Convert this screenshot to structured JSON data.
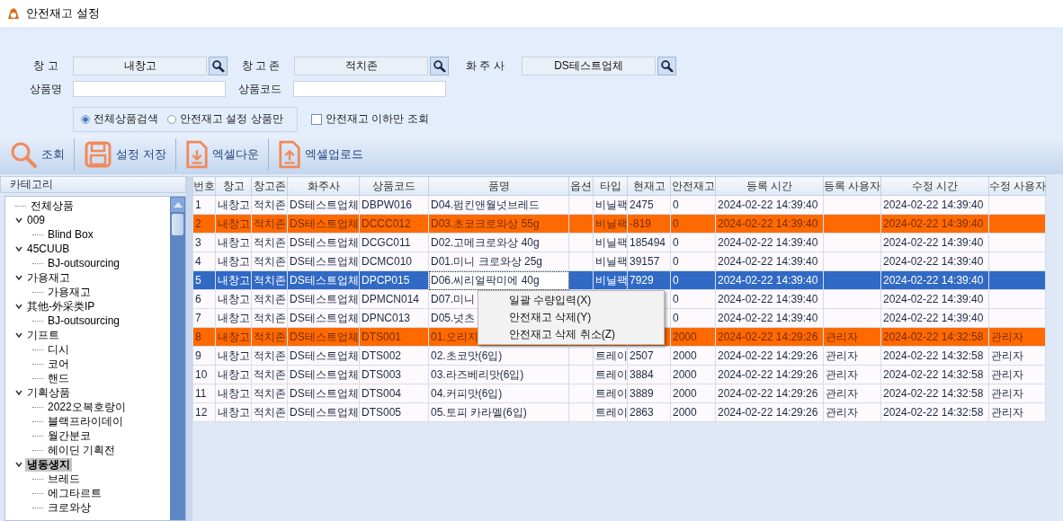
{
  "window": {
    "title": "안전재고 설정"
  },
  "filters": {
    "warehouse": {
      "label": "창 고",
      "value": "내창고"
    },
    "zone": {
      "label": "창 고 존",
      "value": "적치존"
    },
    "owner": {
      "label": "화 주 사",
      "value": "DS테스트업체"
    },
    "product_name": {
      "label": "상품명"
    },
    "product_code": {
      "label": "상품코드"
    },
    "scope": [
      {
        "label": "전체상품검색",
        "selected": true
      },
      {
        "label": "안전재고 설정 상품만",
        "selected": false
      }
    ],
    "below_safety": {
      "label": "안전재고 이하만 조회",
      "checked": false
    }
  },
  "toolbar": [
    {
      "kind": "search",
      "label": "조회"
    },
    {
      "kind": "save",
      "label": "설정 저장"
    },
    {
      "kind": "download",
      "label": "엑셀다운"
    },
    {
      "kind": "upload",
      "label": "엑셀업로드"
    }
  ],
  "category": {
    "title": "카테고리",
    "tree": [
      {
        "label": "전체상품",
        "selected": false
      },
      {
        "label": "009",
        "expanded": true,
        "selected": false,
        "children": [
          {
            "label": "Blind Box",
            "selected": false
          }
        ]
      },
      {
        "label": "45CUUB",
        "expanded": true,
        "selected": false,
        "children": [
          {
            "label": "BJ-outsourcing",
            "selected": false
          }
        ]
      },
      {
        "label": "가용재고",
        "expanded": true,
        "selected": false,
        "children": [
          {
            "label": "가용재고",
            "selected": false
          }
        ]
      },
      {
        "label": "其他-外采类IP",
        "expanded": true,
        "selected": false,
        "children": [
          {
            "label": "BJ-outsourcing",
            "selected": false
          }
        ]
      },
      {
        "label": "기프트",
        "expanded": true,
        "selected": false,
        "children": [
          {
            "label": "디시",
            "selected": false
          },
          {
            "label": "코어",
            "selected": false
          },
          {
            "label": "핸드",
            "selected": false
          }
        ]
      },
      {
        "label": "기획상품",
        "expanded": true,
        "selected": false,
        "children": [
          {
            "label": "2022오복호랑이",
            "selected": false
          },
          {
            "label": "블랙프라이데이",
            "selected": false
          },
          {
            "label": "월간분코",
            "selected": false
          },
          {
            "label": "헤이딘 기획전",
            "selected": false
          }
        ]
      },
      {
        "label": "냉동생지",
        "expanded": true,
        "selected": true,
        "children": [
          {
            "label": "브레드",
            "selected": false
          },
          {
            "label": "에그타르트",
            "selected": false
          },
          {
            "label": "크로와상",
            "selected": false
          }
        ]
      }
    ]
  },
  "table": {
    "columns": [
      "번호",
      "창고",
      "창고존",
      "화주사",
      "상품코드",
      "품명",
      "옵션",
      "타입",
      "현재고",
      "안전재고",
      "등록 시간",
      "등록 사용자",
      "수정 시간",
      "수정 사용자"
    ],
    "rows": [
      {
        "selected": false,
        "highlighted": false,
        "cells": [
          "1",
          "내창고",
          "적치존",
          "DS테스트업체",
          "DBPW016",
          "D04.펌킨앤월넛브레드",
          "",
          "비닐팩",
          "2475",
          "0",
          "2024-02-22 14:39:40",
          "",
          "2024-02-22 14:39:40",
          ""
        ]
      },
      {
        "selected": false,
        "highlighted": true,
        "cells": [
          "2",
          "내창고",
          "적치존",
          "DS테스트업체",
          "DCCC012",
          "D03.초코크로와상 55g",
          "",
          "비닐팩",
          "-819",
          "0",
          "2024-02-22 14:39:40",
          "",
          "2024-02-22 14:39:40",
          ""
        ]
      },
      {
        "selected": false,
        "highlighted": false,
        "cells": [
          "3",
          "내창고",
          "적치존",
          "DS테스트업체",
          "DCGC011",
          "D02.고메크로와상 40g",
          "",
          "비닐팩",
          "185494",
          "0",
          "2024-02-22 14:39:40",
          "",
          "2024-02-22 14:39:40",
          ""
        ]
      },
      {
        "selected": false,
        "highlighted": false,
        "cells": [
          "4",
          "내창고",
          "적치존",
          "DS테스트업체",
          "DCMC010",
          "D01.미니 크로와상 25g",
          "",
          "비닐팩",
          "39157",
          "0",
          "2024-02-22 14:39:40",
          "",
          "2024-02-22 14:39:40",
          ""
        ]
      },
      {
        "selected": true,
        "highlighted": false,
        "cells": [
          "5",
          "내창고",
          "적치존",
          "DS테스트업체",
          "DPCP015",
          "D06.씨리얼팍미에 40g",
          "",
          "비닐팩",
          "7929",
          "0",
          "2024-02-22 14:39:40",
          "",
          "2024-02-22 14:39:40",
          ""
        ]
      },
      {
        "selected": false,
        "highlighted": false,
        "cells": [
          "6",
          "내창고",
          "적치존",
          "DS테스트업체",
          "DPMCN014",
          "D07.미니",
          "",
          "",
          "",
          "0",
          "2024-02-22 14:39:40",
          "",
          "2024-02-22 14:39:40",
          ""
        ]
      },
      {
        "selected": false,
        "highlighted": false,
        "cells": [
          "7",
          "내창고",
          "적치존",
          "DS테스트업체",
          "DPNC013",
          "D05.넛츠",
          "",
          "",
          "",
          "0",
          "2024-02-22 14:39:40",
          "",
          "2024-02-22 14:39:40",
          ""
        ]
      },
      {
        "selected": false,
        "highlighted": true,
        "cells": [
          "8",
          "내창고",
          "적치존",
          "DS테스트업체",
          "DTS001",
          "01.오리지",
          "",
          "",
          "",
          "2000",
          "2024-02-22 14:29:26",
          "관리자",
          "2024-02-22 14:32:58",
          "관리자"
        ]
      },
      {
        "selected": false,
        "highlighted": false,
        "cells": [
          "9",
          "내창고",
          "적치존",
          "DS테스트업체",
          "DTS002",
          "02.초코맛(6입)",
          "",
          "트레이",
          "2507",
          "2000",
          "2024-02-22 14:29:26",
          "관리자",
          "2024-02-22 14:32:58",
          "관리자"
        ]
      },
      {
        "selected": false,
        "highlighted": false,
        "cells": [
          "10",
          "내창고",
          "적치존",
          "DS테스트업체",
          "DTS003",
          "03.라즈베리맛(6입)",
          "",
          "트레이",
          "3884",
          "2000",
          "2024-02-22 14:29:26",
          "관리자",
          "2024-02-22 14:32:58",
          "관리자"
        ]
      },
      {
        "selected": false,
        "highlighted": false,
        "cells": [
          "11",
          "내창고",
          "적치존",
          "DS테스트업체",
          "DTS004",
          "04.커피맛(6입)",
          "",
          "트레이",
          "3889",
          "2000",
          "2024-02-22 14:29:26",
          "관리자",
          "2024-02-22 14:32:58",
          "관리자"
        ]
      },
      {
        "selected": false,
        "highlighted": false,
        "cells": [
          "12",
          "내창고",
          "적치존",
          "DS테스트업체",
          "DTS005",
          "05.토피 카라멜(6입)",
          "",
          "트레이",
          "2863",
          "2000",
          "2024-02-22 14:29:26",
          "관리자",
          "2024-02-22 14:32:58",
          "관리자"
        ]
      }
    ]
  },
  "context_menu": [
    "일괄 수량입력(X)",
    "안전재고 삭제(Y)",
    "안전재고 삭제 취소(Z)"
  ]
}
